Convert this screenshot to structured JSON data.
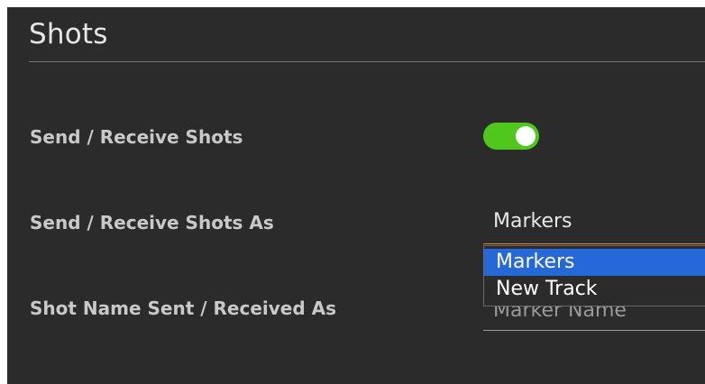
{
  "section": {
    "title": "Shots"
  },
  "settings": {
    "send_receive_label": "Send / Receive Shots",
    "send_receive_toggle_on": true,
    "send_receive_as_label": "Send / Receive Shots As",
    "send_receive_as_value": "Markers",
    "send_receive_as_options": [
      "Markers",
      "New Track"
    ],
    "shot_name_label": "Shot Name Sent / Received As",
    "shot_name_value": "Marker Name"
  },
  "colors": {
    "background": "#2b2b2b",
    "toggle_on": "#4fc71d",
    "option_highlight": "#2768d8",
    "focus_underline": "#d98a2c"
  }
}
